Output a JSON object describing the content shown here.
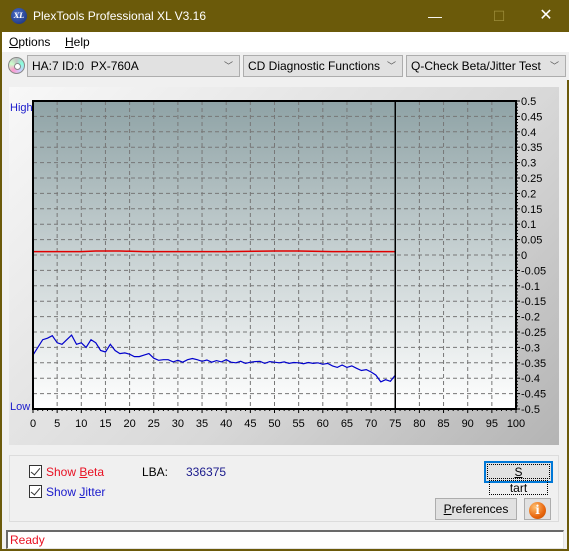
{
  "window": {
    "title": "PlexTools Professional XL V3.16",
    "app_icon": "XL",
    "controls": {
      "minimize": "—",
      "maximize": "☐",
      "close": "✕"
    }
  },
  "menu": {
    "items": [
      {
        "label": "Options",
        "accel": "O"
      },
      {
        "label": "Help",
        "accel": "H"
      }
    ]
  },
  "toolbar": {
    "drive_icon": "disc-icon",
    "drive_select": "HA:7 ID:0  PX-760A",
    "function_select": "CD Diagnostic Functions",
    "test_select": "Q-Check Beta/Jitter Test"
  },
  "chart_data": {
    "type": "line",
    "title": "",
    "xlabel": "",
    "ylabel": "",
    "left_axis_labels": {
      "top": "High",
      "bottom": "Low"
    },
    "xlim": [
      0,
      100
    ],
    "ylim": [
      -0.5,
      0.5
    ],
    "x_ticks": [
      0,
      5,
      10,
      15,
      20,
      25,
      30,
      35,
      40,
      45,
      50,
      55,
      60,
      65,
      70,
      75,
      80,
      85,
      90,
      95,
      100
    ],
    "y_ticks": [
      0.5,
      0.45,
      0.4,
      0.35,
      0.3,
      0.25,
      0.2,
      0.15,
      0.1,
      0.05,
      0,
      -0.05,
      -0.1,
      -0.15,
      -0.2,
      -0.25,
      -0.3,
      -0.35,
      -0.4,
      -0.45,
      -0.5
    ],
    "y_tick_labels": [
      "0.5",
      "0.45",
      "0.4",
      "0.35",
      "0.3",
      "0.25",
      "0.2",
      "0.15",
      "0.1",
      "0.05",
      "0",
      "-0.05",
      "-0.1",
      "-0.15",
      "-0.2",
      "-0.25",
      "-0.3",
      "-0.35",
      "-0.4",
      "-0.45",
      "-0.5"
    ],
    "grid": true,
    "progress_marker_x": 75,
    "series": [
      {
        "name": "Beta",
        "color": "#e00000",
        "x": [
          0,
          5,
          10,
          13,
          18,
          23,
          30,
          40,
          50,
          55,
          62,
          68,
          75
        ],
        "y": [
          0.011,
          0.011,
          0.011,
          0.013,
          0.013,
          0.011,
          0.011,
          0.011,
          0.013,
          0.013,
          0.011,
          0.011,
          0.011
        ]
      },
      {
        "name": "Jitter",
        "color": "#0000cc",
        "x": [
          0,
          1,
          2,
          3,
          4,
          5,
          6,
          7,
          8,
          9,
          10,
          11,
          12,
          13,
          14,
          15,
          16,
          17,
          18,
          19,
          20,
          21,
          22,
          23,
          24,
          25,
          26,
          27,
          28,
          29,
          30,
          31,
          32,
          33,
          34,
          35,
          36,
          37,
          38,
          39,
          40,
          41,
          42,
          43,
          44,
          45,
          46,
          47,
          48,
          49,
          50,
          51,
          52,
          53,
          54,
          55,
          56,
          57,
          58,
          59,
          60,
          61,
          62,
          63,
          64,
          65,
          66,
          67,
          68,
          69,
          70,
          71,
          72,
          73,
          74,
          75
        ],
        "y": [
          -0.325,
          -0.3,
          -0.275,
          -0.27,
          -0.262,
          -0.285,
          -0.29,
          -0.275,
          -0.26,
          -0.29,
          -0.285,
          -0.3,
          -0.275,
          -0.285,
          -0.31,
          -0.315,
          -0.29,
          -0.31,
          -0.32,
          -0.318,
          -0.322,
          -0.33,
          -0.33,
          -0.325,
          -0.32,
          -0.335,
          -0.342,
          -0.34,
          -0.34,
          -0.347,
          -0.342,
          -0.348,
          -0.34,
          -0.336,
          -0.34,
          -0.345,
          -0.341,
          -0.348,
          -0.343,
          -0.347,
          -0.34,
          -0.348,
          -0.35,
          -0.345,
          -0.352,
          -0.348,
          -0.346,
          -0.345,
          -0.352,
          -0.346,
          -0.348,
          -0.35,
          -0.347,
          -0.352,
          -0.349,
          -0.35,
          -0.353,
          -0.349,
          -0.352,
          -0.35,
          -0.355,
          -0.352,
          -0.36,
          -0.365,
          -0.357,
          -0.365,
          -0.36,
          -0.368,
          -0.375,
          -0.372,
          -0.38,
          -0.39,
          -0.412,
          -0.405,
          -0.41,
          -0.39
        ]
      }
    ]
  },
  "controls": {
    "show_beta": {
      "label": "Show Beta",
      "accel": "B",
      "checked": true,
      "color": "#e81123"
    },
    "show_jitter": {
      "label": "Show Jitter",
      "accel": "J",
      "checked": true,
      "color": "#1a1acc"
    },
    "lba_label": "LBA:",
    "lba_value": "336375",
    "start_button": "Start",
    "preferences_button": "Preferences",
    "info_icon": "i"
  },
  "status": {
    "text": "Ready"
  }
}
